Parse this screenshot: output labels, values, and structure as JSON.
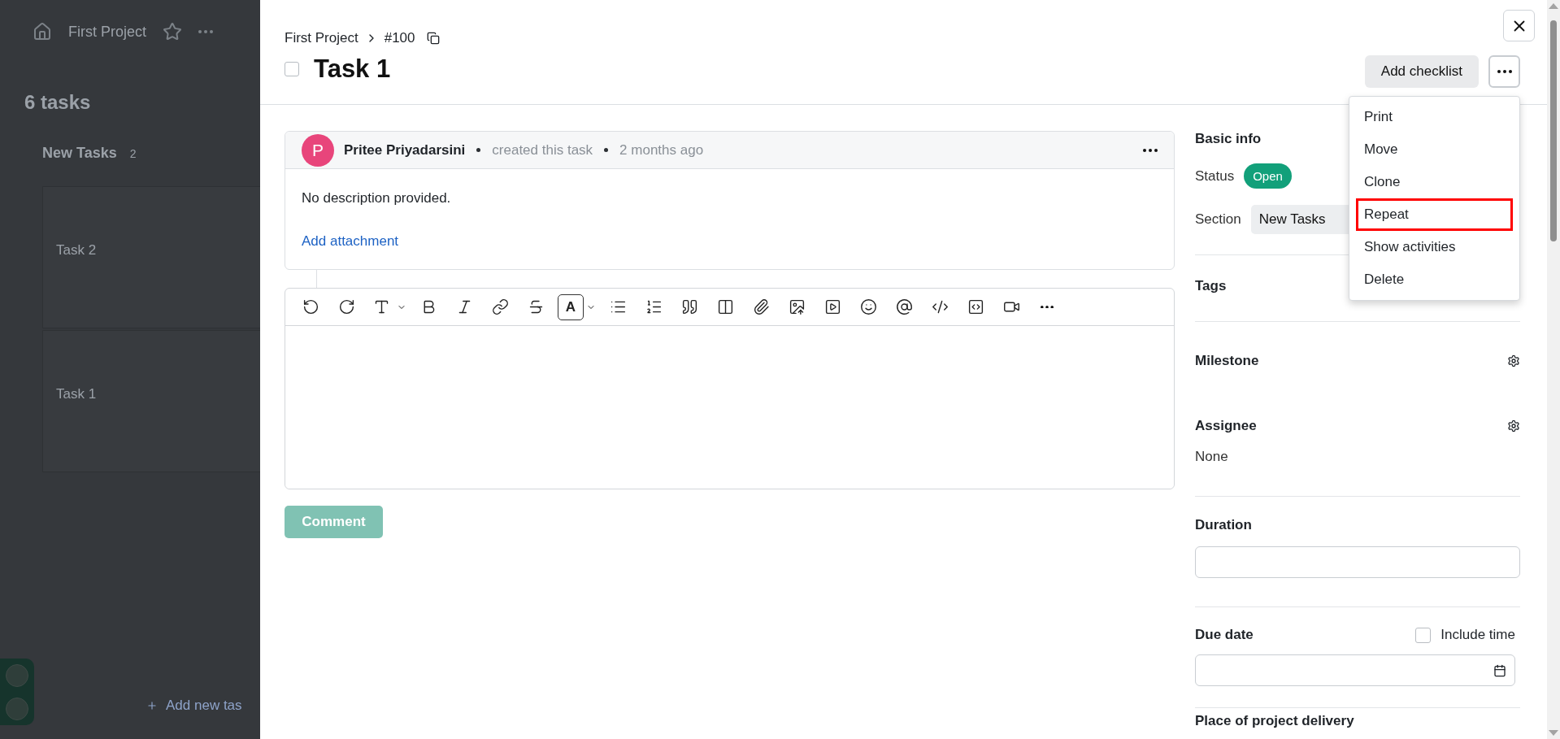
{
  "background": {
    "project": "First Project",
    "task_count": "6 tasks",
    "section": {
      "title": "New Tasks",
      "count": "2"
    },
    "cards": [
      {
        "title": "Task 2"
      },
      {
        "title": "Task 1"
      }
    ],
    "add_task": "Add new tas"
  },
  "task": {
    "project": "First Project",
    "id": "#100",
    "title": "Task 1",
    "completed": false
  },
  "actions": {
    "add_checklist": "Add checklist"
  },
  "menu": [
    {
      "label": "Print",
      "highlighted": false
    },
    {
      "label": "Move",
      "highlighted": false
    },
    {
      "label": "Clone",
      "highlighted": false
    },
    {
      "label": "Repeat",
      "highlighted": true
    },
    {
      "label": "Show activities",
      "highlighted": false
    },
    {
      "label": "Delete",
      "highlighted": false
    }
  ],
  "activity": {
    "avatar_letter": "P",
    "author": "Pritee Priyadarsini",
    "action": "created this task",
    "time": "2 months ago",
    "description": "No description provided.",
    "attachment_link": "Add attachment"
  },
  "editor": {
    "toolbar": [
      {
        "kind": "undo",
        "active": false
      },
      {
        "kind": "redo",
        "active": false
      },
      {
        "kind": "heading",
        "active": false
      },
      {
        "kind": "bold",
        "active": false
      },
      {
        "kind": "italic",
        "active": false
      },
      {
        "kind": "link",
        "active": false
      },
      {
        "kind": "strike",
        "active": false
      },
      {
        "kind": "color",
        "label": "A",
        "active": true
      },
      {
        "kind": "bullets",
        "active": false
      },
      {
        "kind": "numbers",
        "active": false
      },
      {
        "kind": "quote",
        "active": false
      },
      {
        "kind": "columns",
        "active": false
      },
      {
        "kind": "attach",
        "active": false
      },
      {
        "kind": "image",
        "active": false
      },
      {
        "kind": "video",
        "active": false
      },
      {
        "kind": "emoji",
        "active": false
      },
      {
        "kind": "mention",
        "active": false
      },
      {
        "kind": "code",
        "active": false
      },
      {
        "kind": "codeblock",
        "active": false
      },
      {
        "kind": "camera",
        "active": false
      },
      {
        "kind": "more",
        "active": false
      }
    ],
    "submit": "Comment",
    "submit_disabled": true
  },
  "details": {
    "heading": "Basic info",
    "status": {
      "label": "Status",
      "value": "Open"
    },
    "section": {
      "label": "Section",
      "value": "New Tasks"
    },
    "tags": "Tags",
    "milestone": "Milestone",
    "assignee": {
      "label": "Assignee",
      "value": "None"
    },
    "duration": {
      "label": "Duration"
    },
    "due_date": {
      "label": "Due date",
      "include_time": {
        "label": "Include time",
        "checked": false
      }
    },
    "next_section": "Place of project delivery"
  }
}
